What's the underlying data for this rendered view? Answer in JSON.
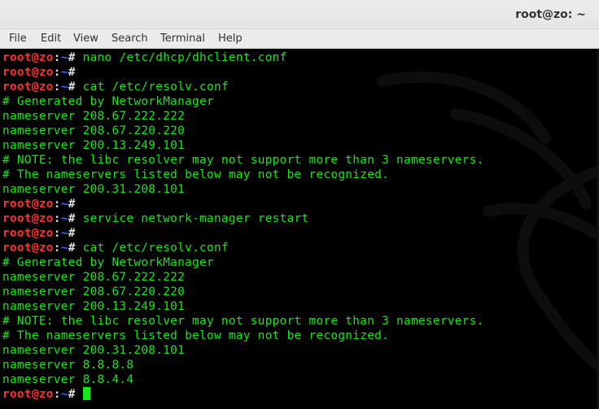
{
  "window": {
    "title": "root@zo: ~"
  },
  "menu": [
    "File",
    "Edit",
    "View",
    "Search",
    "Terminal",
    "Help"
  ],
  "prompt": {
    "user_host": "root@zo",
    "separator": ":",
    "path": "~",
    "symbol": "#"
  },
  "colors": {
    "background": "#000000",
    "output": "#17e717",
    "prompt_user": "#ff3030",
    "prompt_path": "#2f6ff7"
  },
  "terminal_lines": [
    {
      "type": "prompt",
      "command": " nano /etc/dhcp/dhclient.conf"
    },
    {
      "type": "prompt",
      "command": ""
    },
    {
      "type": "prompt",
      "command": " cat /etc/resolv.conf"
    },
    {
      "type": "output",
      "text": "# Generated by NetworkManager"
    },
    {
      "type": "output",
      "text": "nameserver 208.67.222.222"
    },
    {
      "type": "output",
      "text": "nameserver 208.67.220.220"
    },
    {
      "type": "output",
      "text": "nameserver 200.13.249.101"
    },
    {
      "type": "output",
      "text": "# NOTE: the libc resolver may not support more than 3 nameservers."
    },
    {
      "type": "output",
      "text": "# The nameservers listed below may not be recognized."
    },
    {
      "type": "output",
      "text": "nameserver 200.31.208.101"
    },
    {
      "type": "prompt",
      "command": ""
    },
    {
      "type": "prompt",
      "command": " service network-manager restart"
    },
    {
      "type": "prompt",
      "command": ""
    },
    {
      "type": "prompt",
      "command": " cat /etc/resolv.conf"
    },
    {
      "type": "output",
      "text": "# Generated by NetworkManager"
    },
    {
      "type": "output",
      "text": "nameserver 208.67.222.222"
    },
    {
      "type": "output",
      "text": "nameserver 208.67.220.220"
    },
    {
      "type": "output",
      "text": "nameserver 200.13.249.101"
    },
    {
      "type": "output",
      "text": "# NOTE: the libc resolver may not support more than 3 nameservers."
    },
    {
      "type": "output",
      "text": "# The nameservers listed below may not be recognized."
    },
    {
      "type": "output",
      "text": "nameserver 200.31.208.101"
    },
    {
      "type": "output",
      "text": "nameserver 8.8.8.8"
    },
    {
      "type": "output",
      "text": "nameserver 8.8.4.4"
    },
    {
      "type": "prompt",
      "command": " ",
      "cursor": true
    }
  ]
}
